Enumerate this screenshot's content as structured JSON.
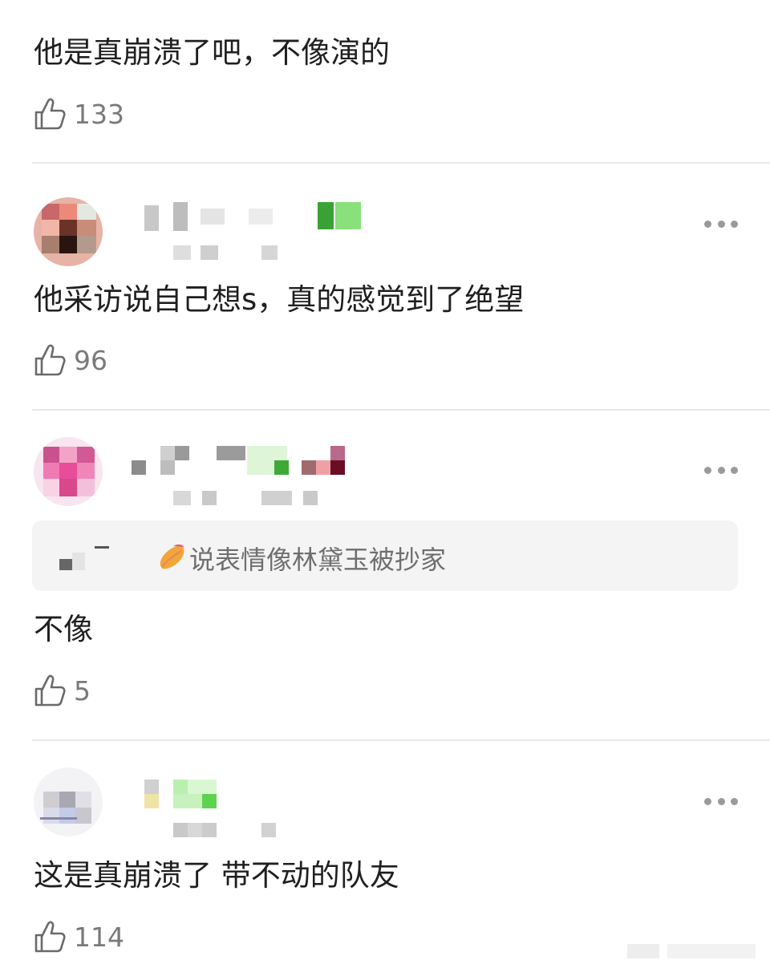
{
  "comments": [
    {
      "text": "他是真崩溃了吧，不像演的",
      "likes": "133"
    },
    {
      "text": "他采访说自己想s，真的感觉到了绝望",
      "likes": "96"
    },
    {
      "quote": "说表情像林黛玉被抄家",
      "text": "不像",
      "likes": "5"
    },
    {
      "text": "这是真崩溃了  带不动的队友",
      "likes": "114"
    }
  ],
  "icons": {
    "like": "thumbs-up-icon",
    "more": "more-dots-icon",
    "quote_emoji": "sweet-potato-icon"
  }
}
